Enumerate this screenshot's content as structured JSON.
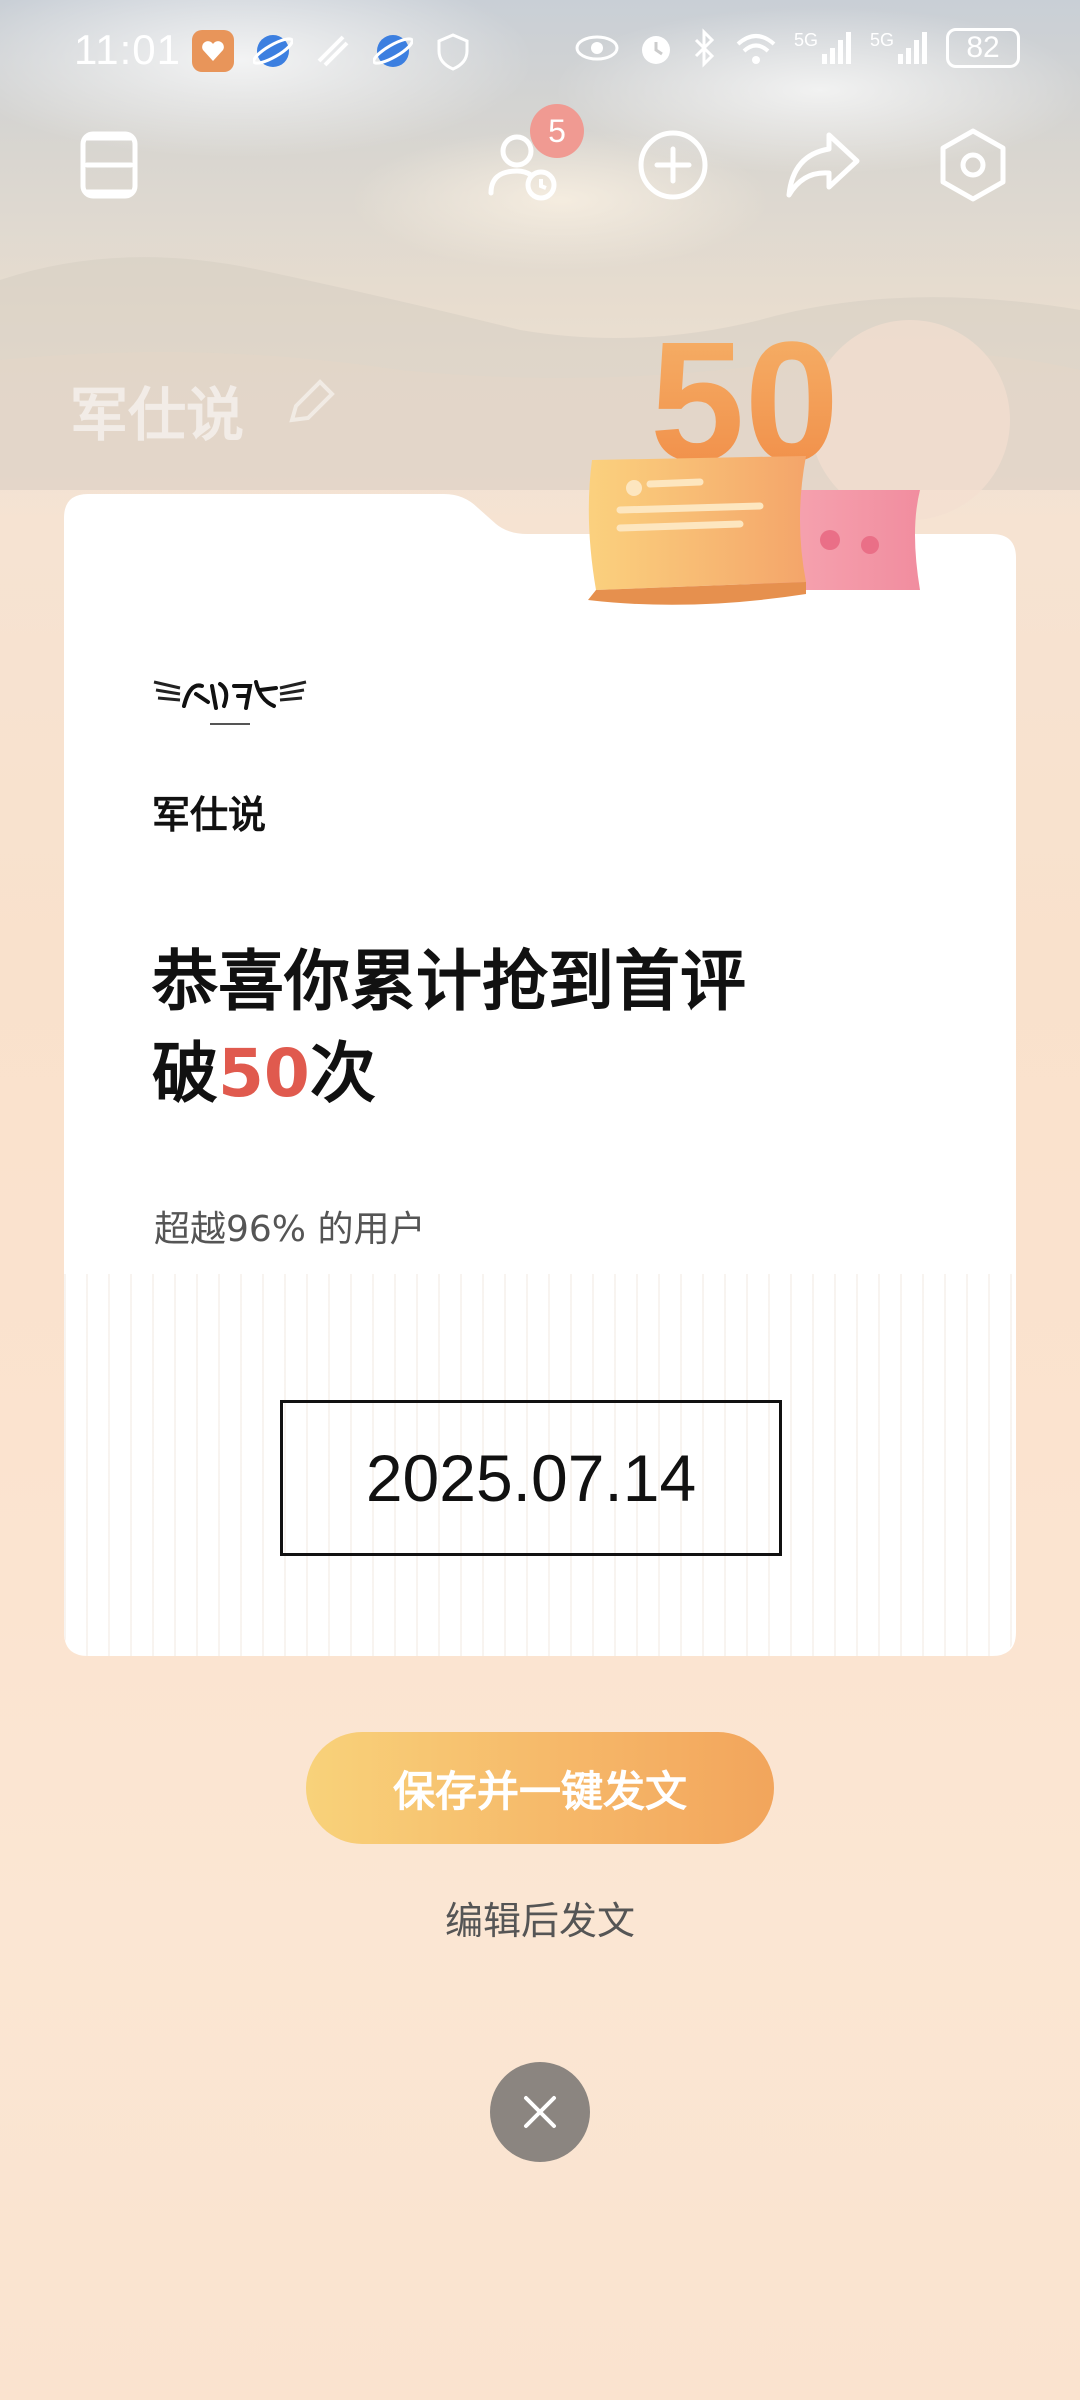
{
  "status_bar": {
    "time": "11:01",
    "battery": "82",
    "network_labels": [
      "5G",
      "5G"
    ]
  },
  "toolbar": {
    "notification_count": "5",
    "icons": [
      "menu-icon",
      "user-clock-icon",
      "add-icon",
      "share-icon",
      "settings-icon"
    ]
  },
  "background": {
    "channel_name": "军仕说"
  },
  "card": {
    "channel_name": "军仕说",
    "headline_prefix": "恭喜你累计抢到首评",
    "headline_line2_prefix": "破",
    "headline_number": "50",
    "headline_line2_suffix": "次",
    "subline": "超越96% 的用户",
    "date": "2025.07.14",
    "emblem_number": "50"
  },
  "actions": {
    "primary_label": "保存并一键发文",
    "secondary_label": "编辑后发文"
  },
  "colors": {
    "accent_red": "#e05a4e",
    "button_gradient_start": "#f8d27a",
    "button_gradient_end": "#f2a55c",
    "badge": "#f09a92",
    "close_button": "#8b8580"
  }
}
